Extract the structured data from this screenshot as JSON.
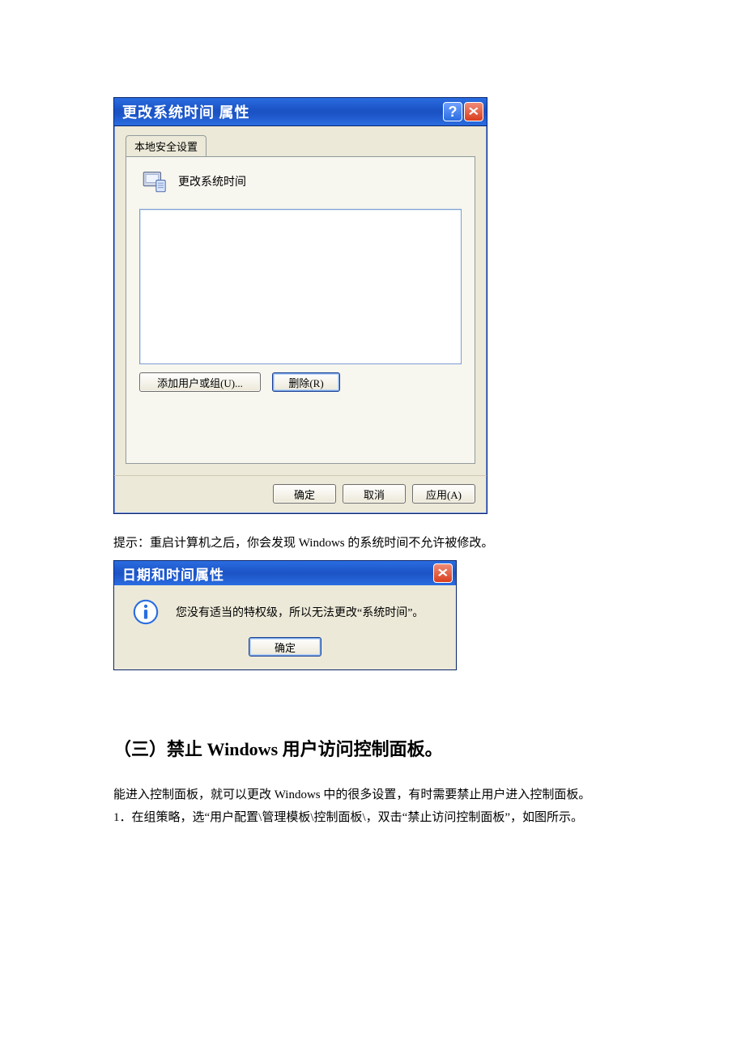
{
  "dialog1": {
    "title": "更改系统时间  属性",
    "tab_label": "本地安全设置",
    "policy_name": "更改系统时间",
    "buttons": {
      "add": "添加用户或组(U)...",
      "remove": "删除(R)"
    },
    "footer": {
      "ok": "确定",
      "cancel": "取消",
      "apply": "应用(A)"
    }
  },
  "note_text": "提示：重启计算机之后，你会发现 Windows 的系统时间不允许被修改。",
  "dialog2": {
    "title": "日期和时间属性",
    "message": "您没有适当的特权级，所以无法更改“系统时间”。",
    "ok": "确定"
  },
  "section": {
    "heading": "（三）禁止 Windows 用户访问控制面板。",
    "p1": "能进入控制面板，就可以更改 Windows 中的很多设置，有时需要禁止用户进入控制面板。",
    "p2": "1．在组策略，选“用户配置\\管理模板\\控制面板\\，双击“禁止访问控制面板”，如图所示。"
  }
}
